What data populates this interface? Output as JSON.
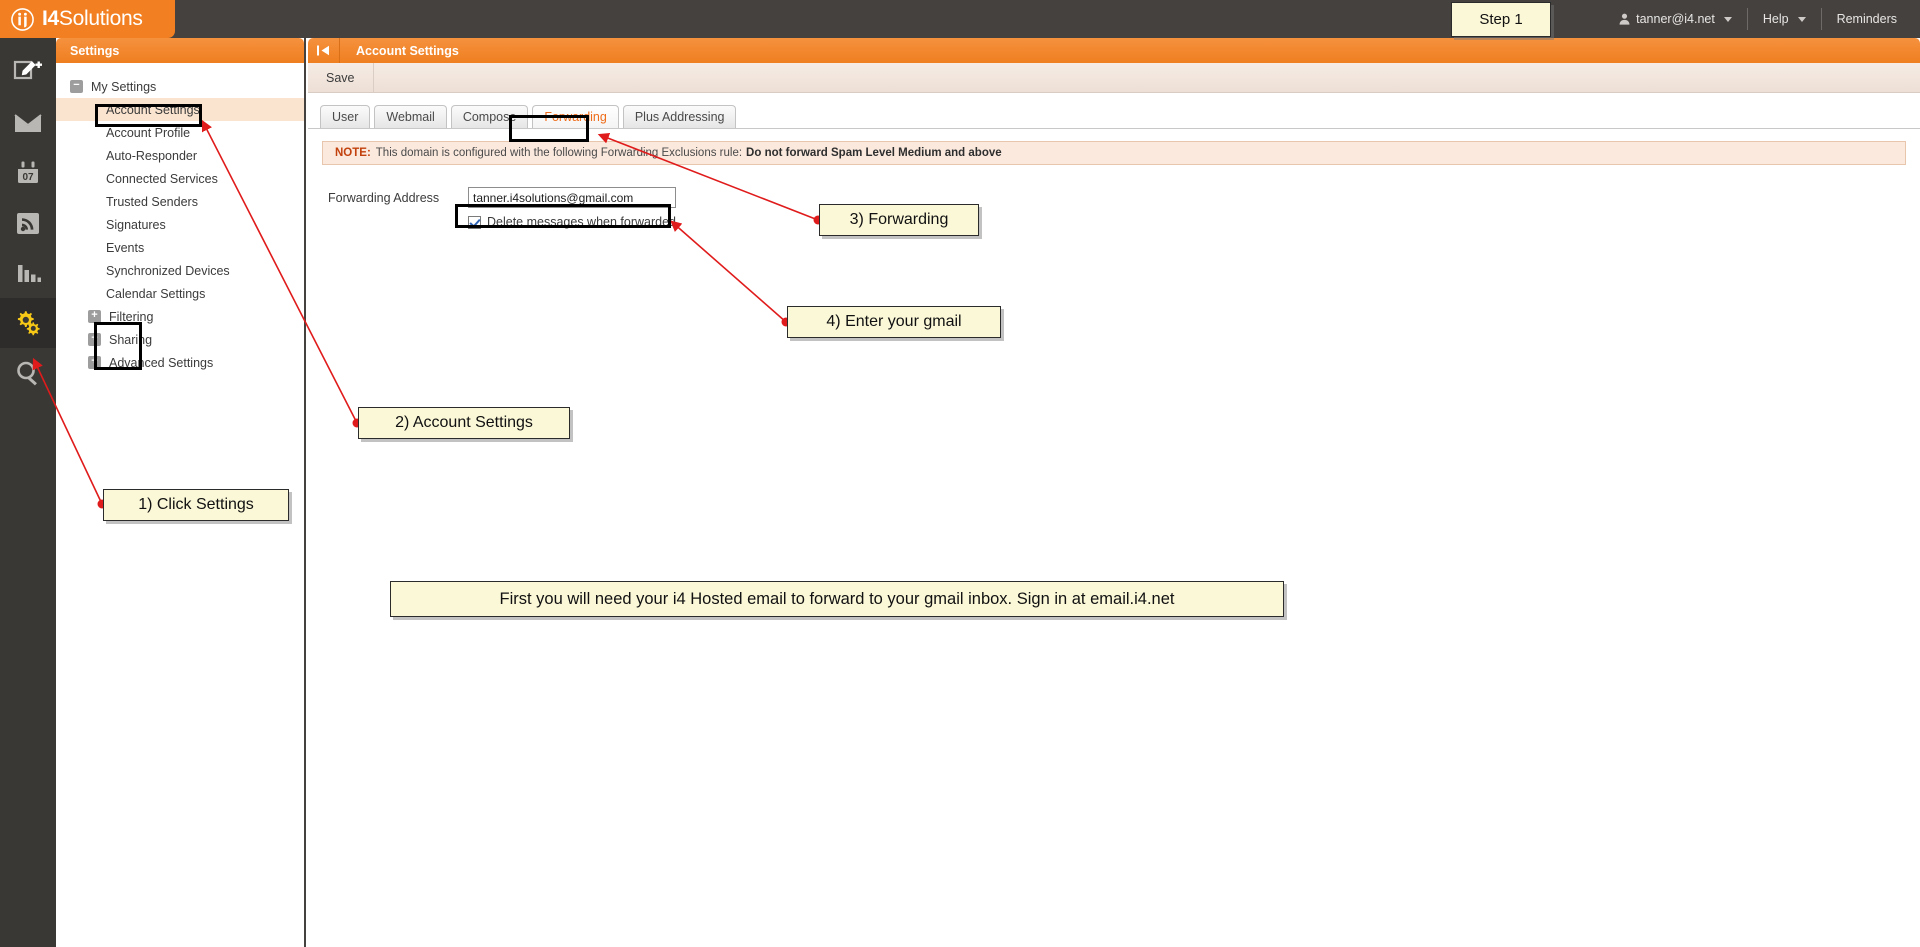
{
  "brand": {
    "name_bold": "I4",
    "name_rest": "Solutions",
    "logo_icon": "circle-i4-logo-icon"
  },
  "topbar": {
    "user": {
      "label": "tanner@i4.net",
      "icon": "person-icon",
      "caret": "chevron-down-icon"
    },
    "help": {
      "label": "Help",
      "caret": "chevron-down-icon"
    },
    "reminders": {
      "label": "Reminders"
    }
  },
  "rail": {
    "items": [
      {
        "name": "compose-icon",
        "title": "Compose"
      },
      {
        "name": "mail-icon",
        "title": "Email"
      },
      {
        "name": "calendar-icon",
        "title": "Calendar",
        "day": "07"
      },
      {
        "name": "rss-feed-icon",
        "title": "News Feeds"
      },
      {
        "name": "chart-bar-icon",
        "title": "Reports"
      },
      {
        "name": "gears-settings-icon",
        "title": "Settings",
        "active": true
      },
      {
        "name": "search-magnifier-icon",
        "title": "Search"
      }
    ]
  },
  "sidebar": {
    "header": "Settings",
    "tree": [
      {
        "label": "My Settings",
        "level": "root",
        "toggle": "−"
      },
      {
        "label": "Account Settings",
        "level": "child",
        "selected": true
      },
      {
        "label": "Account Profile",
        "level": "child"
      },
      {
        "label": "Auto-Responder",
        "level": "child"
      },
      {
        "label": "Connected Services",
        "level": "child"
      },
      {
        "label": "Trusted Senders",
        "level": "child"
      },
      {
        "label": "Signatures",
        "level": "child"
      },
      {
        "label": "Events",
        "level": "child"
      },
      {
        "label": "Synchronized Devices",
        "level": "child"
      },
      {
        "label": "Calendar Settings",
        "level": "child"
      },
      {
        "label": "Filtering",
        "level": "group",
        "toggle": "+"
      },
      {
        "label": "Sharing",
        "level": "group",
        "toggle": "+"
      },
      {
        "label": "Advanced Settings",
        "level": "group",
        "toggle": "+"
      }
    ]
  },
  "content": {
    "collapse_icon": "collapse-panel-icon",
    "title": "Account Settings",
    "toolbar": {
      "save_label": "Save"
    },
    "tabs": [
      {
        "label": "User",
        "active": false
      },
      {
        "label": "Webmail",
        "active": false
      },
      {
        "label": "Compose",
        "active": false
      },
      {
        "label": "Forwarding",
        "active": true
      },
      {
        "label": "Plus Addressing",
        "active": false
      }
    ],
    "note": {
      "prefix": "NOTE:",
      "text": "This domain is configured with the following Forwarding Exclusions rule:",
      "rule": "Do not forward Spam Level Medium and above"
    },
    "form": {
      "address_label": "Forwarding Address",
      "address_value": "tanner.i4solutions@gmail.com",
      "address_placeholder": "",
      "delete_checkbox_label": "Delete messages when forwarded",
      "delete_checkbox_checked": true
    }
  },
  "annotations": {
    "step_badge": "Step 1",
    "callout_1": "1) Click Settings",
    "callout_2": "2) Account Settings",
    "callout_3": "3) Forwarding",
    "callout_4": "4) Enter your gmail",
    "banner": "First you will need your i4 Hosted email to forward to your gmail inbox. Sign in at email.i4.net"
  },
  "colors": {
    "brand_orange": "#f28022",
    "topbar_dark": "#44413f",
    "rail_dark": "#3a3835",
    "annotation_yellow": "#fbf8d8",
    "arrow_red": "#e01b1b",
    "active_tab_text": "#ef6c1a",
    "note_label": "#c2410c"
  }
}
